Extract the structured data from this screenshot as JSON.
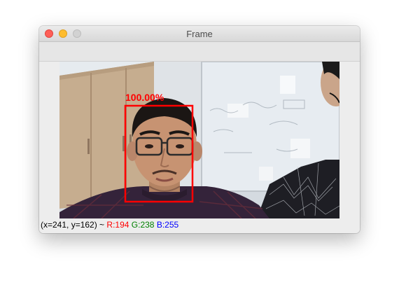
{
  "window": {
    "title": "Frame"
  },
  "colors": {
    "detection_box": "#ff0000",
    "red_channel": "#ff0000",
    "green_channel": "#008000",
    "blue_channel": "#0000ff"
  },
  "icons": {
    "close": "close-icon",
    "minimize": "minimize-icon",
    "zoom": "zoom-icon"
  },
  "detection": {
    "confidence_label": "100.00%"
  },
  "status": {
    "coords": "(x=241, y=162) ~",
    "r": "R:194",
    "g": "G:238",
    "b": "B:255"
  }
}
